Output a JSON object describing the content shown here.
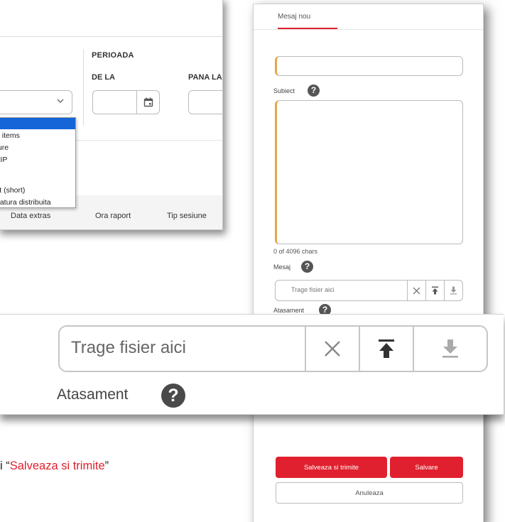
{
  "filter": {
    "section_title": "PERIOADA",
    "from_label": "DE LA",
    "to_label": "PANA LA",
    "dropdown_options": [
      "",
      "d items",
      "ture",
      "ZIP",
      "",
      "st (short)",
      "natura distribuita"
    ],
    "table_headers": [
      "Data extras",
      "Ora raport",
      "Tip sesiune"
    ]
  },
  "message_form": {
    "tab_label": "Mesaj nou",
    "subject_label": "Subiect",
    "message_label": "Mesaj",
    "char_counter": "0 of 4096 chars",
    "file_placeholder": "Trage fisier aici",
    "attachment_label": "Atasament",
    "save_send_label": "Salveaza si trimite",
    "save_label": "Salvare",
    "cancel_label": "Anuleaza",
    "help_glyph": "?"
  },
  "zoom": {
    "file_placeholder": "Trage fisier aici",
    "attachment_label": "Atasament",
    "help_glyph": "?"
  },
  "caption": {
    "prefix": "i “",
    "highlight": "Salveaza si trimite",
    "suffix": "”"
  },
  "colors": {
    "accent_red": "#e0202e",
    "input_accent": "#e6a64a",
    "select_highlight": "#1565d8"
  }
}
